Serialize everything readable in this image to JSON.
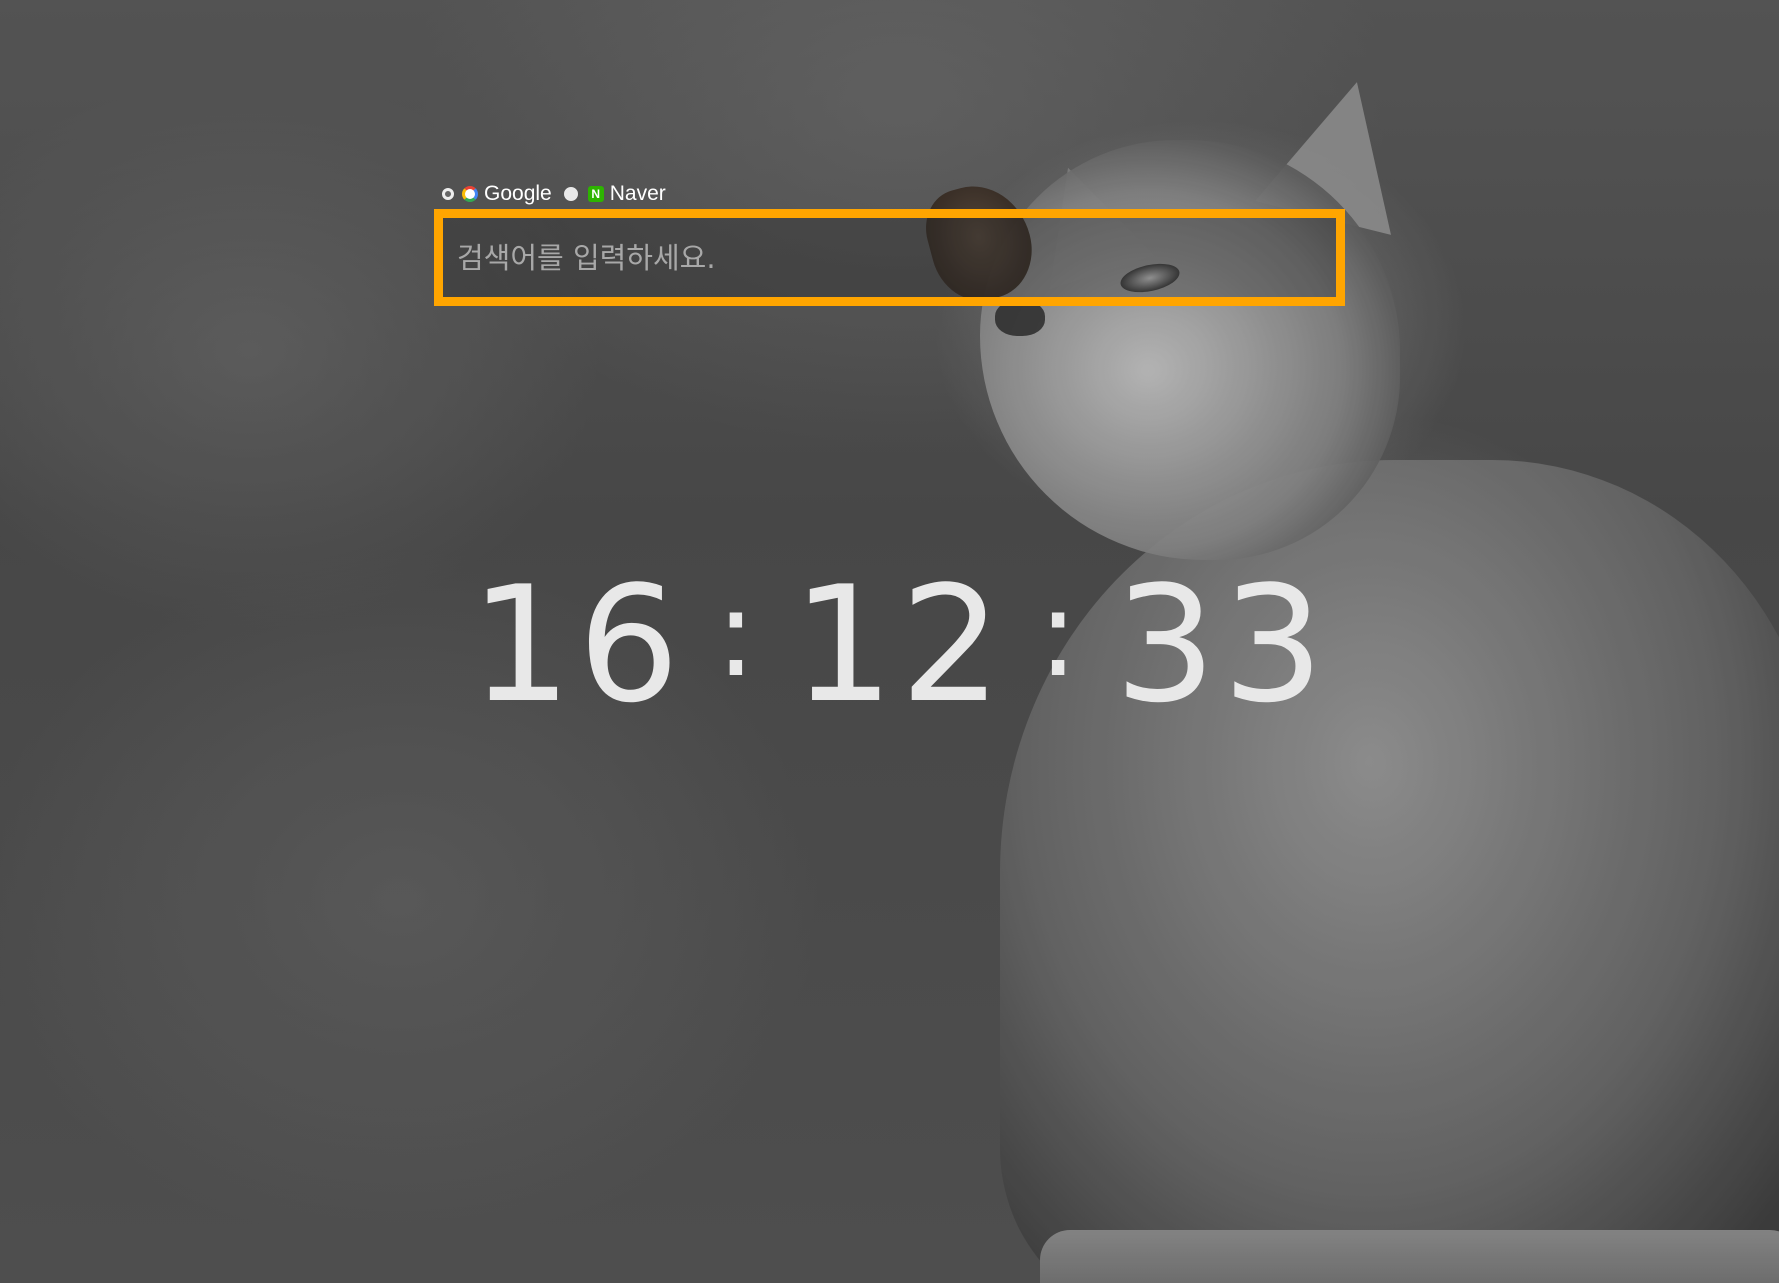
{
  "search_engines": [
    {
      "label": "Google",
      "icon": "google-icon",
      "selected": true
    },
    {
      "label": "Naver",
      "icon": "naver-icon",
      "selected": false
    }
  ],
  "naver_icon_letter": "N",
  "search": {
    "placeholder": "검색어를 입력하세요.",
    "value": ""
  },
  "clock": {
    "hours": "16",
    "minutes": "12",
    "seconds": "33",
    "separator": ":"
  },
  "colors": {
    "search_border": "#ffa500",
    "clock_text": "#e8e8e8"
  }
}
